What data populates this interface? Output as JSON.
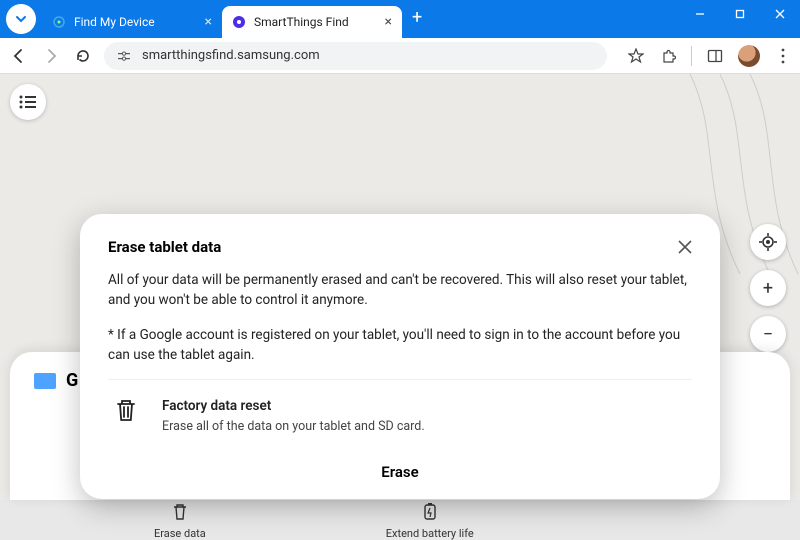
{
  "browser": {
    "tabs": [
      {
        "title": "Find My Device"
      },
      {
        "title": "SmartThings Find"
      }
    ],
    "url": "smartthingsfind.samsung.com"
  },
  "page": {
    "device_name_initial": "G",
    "actions": {
      "erase": "Erase data",
      "battery": "Extend battery life"
    }
  },
  "modal": {
    "title": "Erase tablet data",
    "p1": "All of your data will be permanently erased and can't be recovered. This will also reset your tablet, and you won't be able to control it anymore.",
    "p2": "* If a Google account is registered on your tablet, you'll need to sign in to the account before you can use the tablet again.",
    "reset_title": "Factory data reset",
    "reset_desc": "Erase all of the data on your tablet and SD card.",
    "confirm": "Erase"
  }
}
